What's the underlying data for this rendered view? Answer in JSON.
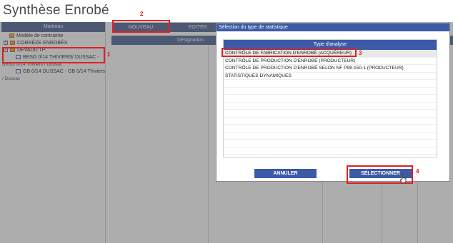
{
  "page": {
    "title": "Synthèse Enrobé"
  },
  "left_panel": {
    "header": "Matériau",
    "tree": [
      {
        "label": "Modèle de contrainte",
        "icon": "folder-icon"
      },
      {
        "label": "CORRÈZE ENROBÉS",
        "icon": "expand-icon"
      },
      {
        "label": "DEVAUD TP",
        "icon": "expand-icon"
      },
      {
        "label": "BBSG 0/14 THIVIERS/ DUSSAC -",
        "icon": "document-icon"
      },
      {
        "label": "BBSG 0/14 Thiviers / Dussac",
        "icon": ""
      },
      {
        "label": "GB 0/14 DUSSAC - GB 0/14 Thiviers",
        "icon": "document-icon"
      },
      {
        "label": "/ Dussac",
        "icon": ""
      }
    ]
  },
  "toolbar": {
    "new_label": "NOUVEAU",
    "edit_label": "EDITER"
  },
  "grid": {
    "column_header": "Désignation"
  },
  "annotations": {
    "one": "1",
    "two": "2",
    "three": "3",
    "four": "4"
  },
  "modal": {
    "title": "Sélection du type de statistique",
    "list_header": "Type d'analyse",
    "options": [
      "CONTRÔLE DE FABRICATION D'ENROBÉ (ACQUÉREUR)",
      "CONTRÔLE DE PRODUCTION D'ENROBÉ (PRODUCTEUR)",
      "CONTRÔLE DE PRODUCTION D'ENROBÉ SELON NF P98-150-1 (PRODUCTEUR)",
      "STATISTIQUES DYNAMIQUES"
    ],
    "selected_index": 0,
    "cancel_label": "ANNULER",
    "select_label": "SÉLECTIONNER"
  },
  "colors": {
    "accent": "#3d5aa8",
    "annotation": "#e02020"
  }
}
